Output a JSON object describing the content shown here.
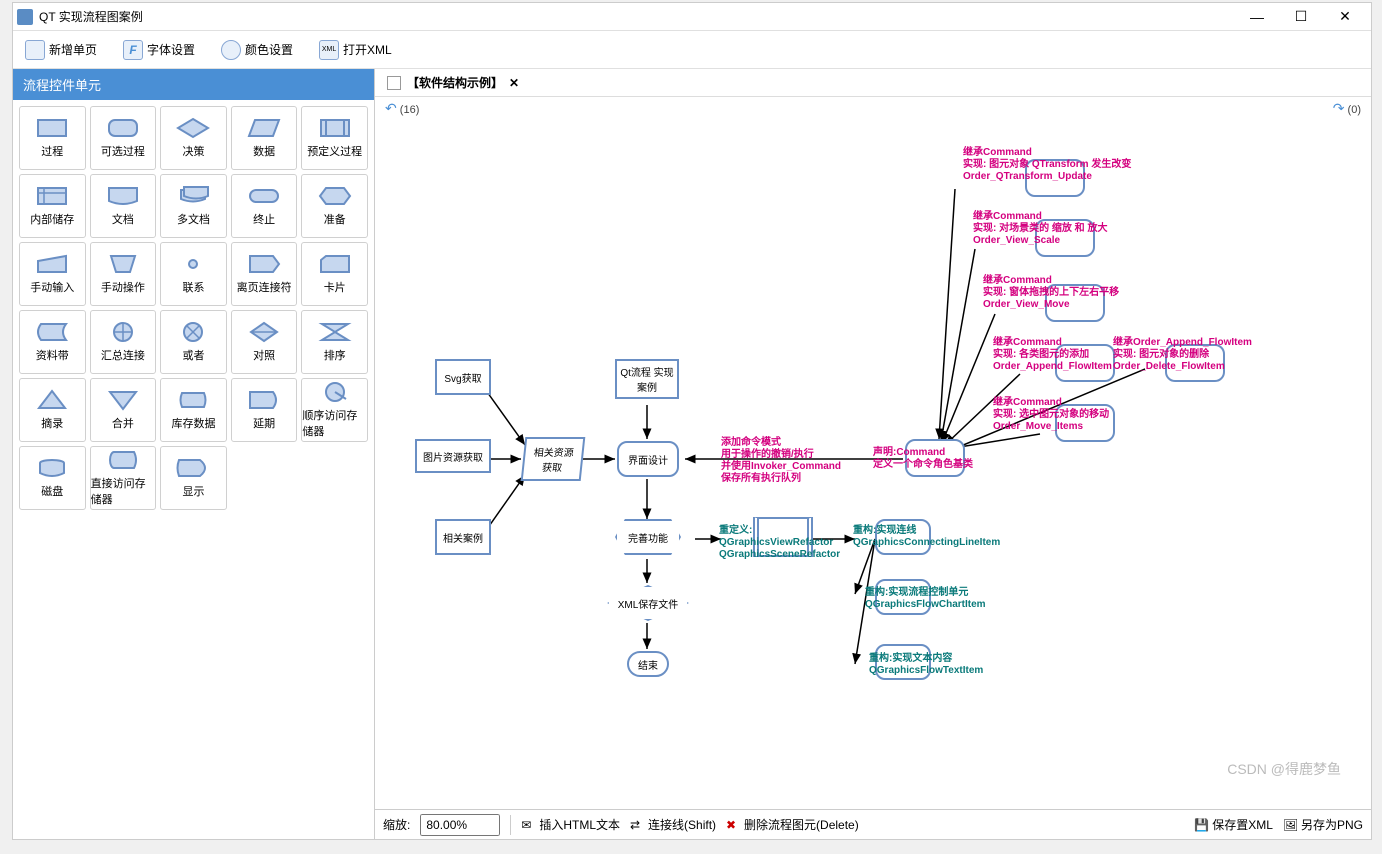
{
  "window": {
    "title": "QT 实现流程图案例"
  },
  "toolbar": {
    "new_page": "新增单页",
    "font_settings": "字体设置",
    "color_settings": "颜色设置",
    "open_xml": "打开XML"
  },
  "sidebar": {
    "header": "流程控件单元",
    "shapes": [
      "过程",
      "可选过程",
      "决策",
      "数据",
      "预定义过程",
      "内部储存",
      "文档",
      "多文档",
      "终止",
      "准备",
      "手动输入",
      "手动操作",
      "联系",
      "离页连接符",
      "卡片",
      "资料带",
      "汇总连接",
      "或者",
      "对照",
      "排序",
      "摘录",
      "合并",
      "库存数据",
      "延期",
      "顺序访问存储器",
      "磁盘",
      "直接访问存储器",
      "显示"
    ]
  },
  "tab": {
    "title": "【软件结构示例】"
  },
  "history": {
    "undo_count": "(16)",
    "redo_count": "(0)"
  },
  "nodes": {
    "svg_get": "Svg获取",
    "qt_case": "Qt流程\n实现案例",
    "img_res": "图片资源获取",
    "rel_res": "相关资源\n获取",
    "ui_design": "界面设计",
    "rel_case": "相关案例",
    "perfect": "完善功能",
    "xml_save": "XML保存文件",
    "end": "结束",
    "cmd_decl": "声明:Command\n定义一个命令角色基类"
  },
  "annots": {
    "a1": "继承Command\n实现: 图元对象 QTransform 发生改变\nOrder_QTransform_Update",
    "a2": "继承Command\n实现: 对场景类的 缩放 和 放大\nOrder_View_Scale",
    "a3": "继承Command\n实现: 窗体拖拽的上下左右平移\nOrder_View_Move",
    "a4": "继承Command\n实现: 各类图元的添加\nOrder_Append_FlowItem",
    "a4b": "继承Order_Append_FlowItem\n实现: 图元对象的删除\nOrder_Delete_FlowItem",
    "a5": "继承Command\n实现: 选中图元对象的移动\nOrder_Move_Items",
    "mode": "添加命令模式\n用于操作的撤销/执行\n并使用Invoker_Command\n保存所有执行队列",
    "redef": "重定义:\nQGraphicsViewRefactor\nQGraphicsSceneRefactor",
    "r_line": "重构:实现连线\nQGraphicsConnectingLineItem",
    "r_flow": "重构:实现流程控制单元\nQGraphicsFlowChartItem",
    "r_text": "重构:实现文本内容\nQGraphicsFlowTextItem"
  },
  "status": {
    "zoom_label": "缩放:",
    "zoom_value": "80.00%",
    "insert_html": "插入HTML文本",
    "connector": "连接线(Shift)",
    "delete": "删除流程图元(Delete)",
    "save_xml": "保存置XML",
    "save_png": "另存为PNG"
  },
  "watermark": "CSDN @得鹿梦鱼"
}
